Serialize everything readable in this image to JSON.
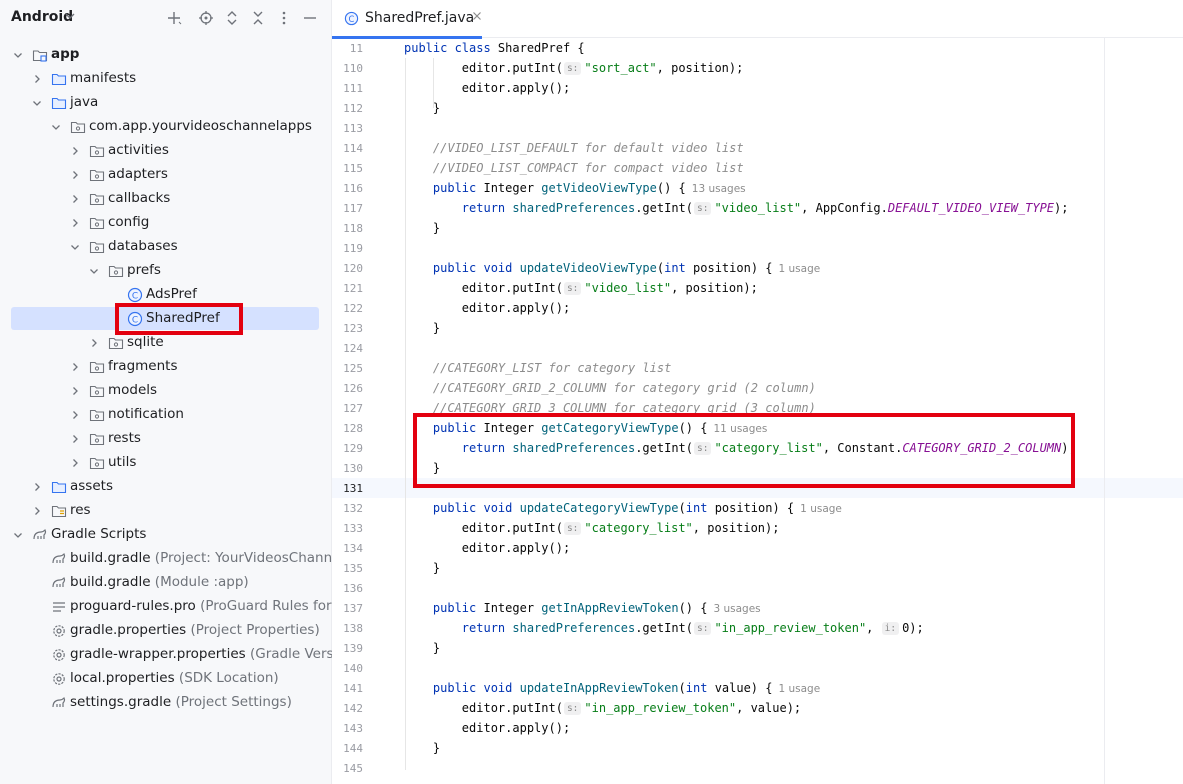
{
  "sidebar": {
    "title": "Android",
    "toolbar": [
      "add-icon",
      "locate-icon",
      "expand-all-icon",
      "collapse-all-icon",
      "more-icon",
      "hide-icon"
    ],
    "tree": [
      {
        "label": "app",
        "hint": "",
        "bold": true,
        "icon": "module",
        "arrow": "down"
      },
      {
        "label": "manifests",
        "hint": "",
        "icon": "folder",
        "arrow": "right"
      },
      {
        "label": "java",
        "hint": "",
        "icon": "folder",
        "arrow": "down"
      },
      {
        "label": "com.app.yourvideoschannelapps",
        "hint": "",
        "icon": "package",
        "arrow": "down"
      },
      {
        "label": "activities",
        "hint": "",
        "icon": "package",
        "arrow": "right"
      },
      {
        "label": "adapters",
        "hint": "",
        "icon": "package",
        "arrow": "right"
      },
      {
        "label": "callbacks",
        "hint": "",
        "icon": "package",
        "arrow": "right"
      },
      {
        "label": "config",
        "hint": "",
        "icon": "package",
        "arrow": "right"
      },
      {
        "label": "databases",
        "hint": "",
        "icon": "package",
        "arrow": "down"
      },
      {
        "label": "prefs",
        "hint": "",
        "icon": "package",
        "arrow": "down"
      },
      {
        "label": "AdsPref",
        "hint": "",
        "icon": "class",
        "arrow": ""
      },
      {
        "label": "SharedPref",
        "hint": "",
        "icon": "class",
        "arrow": "",
        "selected": true
      },
      {
        "label": "sqlite",
        "hint": "",
        "icon": "package",
        "arrow": "right"
      },
      {
        "label": "fragments",
        "hint": "",
        "icon": "package",
        "arrow": "right"
      },
      {
        "label": "models",
        "hint": "",
        "icon": "package",
        "arrow": "right"
      },
      {
        "label": "notification",
        "hint": "",
        "icon": "package",
        "arrow": "right"
      },
      {
        "label": "rests",
        "hint": "",
        "icon": "package",
        "arrow": "right"
      },
      {
        "label": "utils",
        "hint": "",
        "icon": "package",
        "arrow": "right"
      },
      {
        "label": "assets",
        "hint": "",
        "icon": "folder",
        "arrow": "right"
      },
      {
        "label": "res",
        "hint": "",
        "icon": "res",
        "arrow": "right"
      },
      {
        "label": "Gradle Scripts",
        "hint": "",
        "icon": "gradle",
        "arrow": "down"
      },
      {
        "label": "build.gradle",
        "hint": "(Project: YourVideosChannel_",
        "icon": "gradle",
        "arrow": ""
      },
      {
        "label": "build.gradle",
        "hint": "(Module :app)",
        "icon": "gradle",
        "arrow": ""
      },
      {
        "label": "proguard-rules.pro",
        "hint": "(ProGuard Rules for \":",
        "icon": "lines",
        "arrow": ""
      },
      {
        "label": "gradle.properties",
        "hint": "(Project Properties)",
        "icon": "gear",
        "arrow": ""
      },
      {
        "label": "gradle-wrapper.properties",
        "hint": "(Gradle Versio",
        "icon": "gear",
        "arrow": ""
      },
      {
        "label": "local.properties",
        "hint": "(SDK Location)",
        "icon": "gear",
        "arrow": ""
      },
      {
        "label": "settings.gradle",
        "hint": "(Project Settings)",
        "icon": "gradle",
        "arrow": ""
      }
    ]
  },
  "editor": {
    "tab_label": "SharedPref.java",
    "current_line": "131",
    "lines": [
      {
        "n": "11",
        "s": [
          [
            "kw",
            "public class "
          ],
          [
            "",
            "SharedPref {"
          ]
        ]
      },
      {
        "n": "110",
        "s": [
          [
            "",
            "        editor.putInt("
          ],
          [
            "hint",
            "s:"
          ],
          [
            "st",
            "\"sort_act\""
          ],
          [
            "",
            ", position);"
          ]
        ]
      },
      {
        "n": "111",
        "s": [
          [
            "",
            "        editor.apply();"
          ]
        ]
      },
      {
        "n": "112",
        "s": [
          [
            "",
            "    }"
          ]
        ]
      },
      {
        "n": "113",
        "s": []
      },
      {
        "n": "114",
        "s": [
          [
            "cm",
            "    //VIDEO_LIST_DEFAULT for default video list"
          ]
        ]
      },
      {
        "n": "115",
        "s": [
          [
            "cm",
            "    //VIDEO_LIST_COMPACT for compact video list"
          ]
        ]
      },
      {
        "n": "116",
        "s": [
          [
            "kw",
            "    public "
          ],
          [
            "",
            "Integer "
          ],
          [
            "fn",
            "getVideoViewType"
          ],
          [
            "",
            "() {"
          ],
          [
            "use",
            "13 usages"
          ]
        ]
      },
      {
        "n": "117",
        "s": [
          [
            "kw",
            "        return "
          ],
          [
            "fn",
            "sharedPreferences"
          ],
          [
            "",
            ".getInt("
          ],
          [
            "hint",
            "s:"
          ],
          [
            "st",
            "\"video_list\""
          ],
          [
            "",
            ", AppConfig."
          ],
          [
            "ct",
            "DEFAULT_VIDEO_VIEW_TYPE"
          ],
          [
            "",
            ");"
          ]
        ]
      },
      {
        "n": "118",
        "s": [
          [
            "",
            "    }"
          ]
        ]
      },
      {
        "n": "119",
        "s": []
      },
      {
        "n": "120",
        "s": [
          [
            "kw",
            "    public void "
          ],
          [
            "fn",
            "updateVideoViewType"
          ],
          [
            "",
            "("
          ],
          [
            "kw",
            "int "
          ],
          [
            "",
            "position) {"
          ],
          [
            "use",
            "1 usage"
          ]
        ]
      },
      {
        "n": "121",
        "s": [
          [
            "",
            "        editor.putInt("
          ],
          [
            "hint",
            "s:"
          ],
          [
            "st",
            "\"video_list\""
          ],
          [
            "",
            ", position);"
          ]
        ]
      },
      {
        "n": "122",
        "s": [
          [
            "",
            "        editor.apply();"
          ]
        ]
      },
      {
        "n": "123",
        "s": [
          [
            "",
            "    }"
          ]
        ]
      },
      {
        "n": "124",
        "s": []
      },
      {
        "n": "125",
        "s": [
          [
            "cm",
            "    //CATEGORY_LIST for category list"
          ]
        ]
      },
      {
        "n": "126",
        "s": [
          [
            "cm",
            "    //CATEGORY_GRID_2_COLUMN for category grid (2 column)"
          ]
        ]
      },
      {
        "n": "127",
        "s": [
          [
            "cm",
            "    //CATEGORY_GRID_3_COLUMN for category grid (3 column)"
          ]
        ]
      },
      {
        "n": "128",
        "s": [
          [
            "kw",
            "    public "
          ],
          [
            "",
            "Integer "
          ],
          [
            "fn",
            "getCategoryViewType"
          ],
          [
            "",
            "() {"
          ],
          [
            "use",
            "11 usages"
          ]
        ]
      },
      {
        "n": "129",
        "s": [
          [
            "kw",
            "        return "
          ],
          [
            "fn",
            "sharedPreferences"
          ],
          [
            "",
            ".getInt("
          ],
          [
            "hint",
            "s:"
          ],
          [
            "st",
            "\"category_list\""
          ],
          [
            "",
            ", Constant."
          ],
          [
            "ct",
            "CATEGORY_GRID_2_COLUMN"
          ],
          [
            "",
            ");"
          ]
        ]
      },
      {
        "n": "130",
        "s": [
          [
            "",
            "    }"
          ]
        ]
      },
      {
        "n": "131",
        "s": []
      },
      {
        "n": "132",
        "s": [
          [
            "kw",
            "    public void "
          ],
          [
            "fn",
            "updateCategoryViewType"
          ],
          [
            "",
            "("
          ],
          [
            "kw",
            "int "
          ],
          [
            "",
            "position) {"
          ],
          [
            "use",
            "1 usage"
          ]
        ]
      },
      {
        "n": "133",
        "s": [
          [
            "",
            "        editor.putInt("
          ],
          [
            "hint",
            "s:"
          ],
          [
            "st",
            "\"category_list\""
          ],
          [
            "",
            ", position);"
          ]
        ]
      },
      {
        "n": "134",
        "s": [
          [
            "",
            "        editor.apply();"
          ]
        ]
      },
      {
        "n": "135",
        "s": [
          [
            "",
            "    }"
          ]
        ]
      },
      {
        "n": "136",
        "s": []
      },
      {
        "n": "137",
        "s": [
          [
            "kw",
            "    public "
          ],
          [
            "",
            "Integer "
          ],
          [
            "fn",
            "getInAppReviewToken"
          ],
          [
            "",
            "() {"
          ],
          [
            "use",
            "3 usages"
          ]
        ]
      },
      {
        "n": "138",
        "s": [
          [
            "kw",
            "        return "
          ],
          [
            "fn",
            "sharedPreferences"
          ],
          [
            "",
            ".getInt("
          ],
          [
            "hint",
            "s:"
          ],
          [
            "st",
            "\"in_app_review_token\""
          ],
          [
            "",
            ", "
          ],
          [
            "hint",
            "i:"
          ],
          [
            "",
            "0);"
          ]
        ]
      },
      {
        "n": "139",
        "s": [
          [
            "",
            "    }"
          ]
        ]
      },
      {
        "n": "140",
        "s": []
      },
      {
        "n": "141",
        "s": [
          [
            "kw",
            "    public void "
          ],
          [
            "fn",
            "updateInAppReviewToken"
          ],
          [
            "",
            "("
          ],
          [
            "kw",
            "int "
          ],
          [
            "",
            "value) {"
          ],
          [
            "use",
            "1 usage"
          ]
        ]
      },
      {
        "n": "142",
        "s": [
          [
            "",
            "        editor.putInt("
          ],
          [
            "hint",
            "s:"
          ],
          [
            "st",
            "\"in_app_review_token\""
          ],
          [
            "",
            ", value);"
          ]
        ]
      },
      {
        "n": "143",
        "s": [
          [
            "",
            "        editor.apply();"
          ]
        ]
      },
      {
        "n": "144",
        "s": [
          [
            "",
            "    }"
          ]
        ]
      },
      {
        "n": "145",
        "s": []
      }
    ]
  },
  "colors": {
    "annotation": "#e3000f",
    "selection": "#d5e1ff",
    "accent": "#3574f0"
  }
}
